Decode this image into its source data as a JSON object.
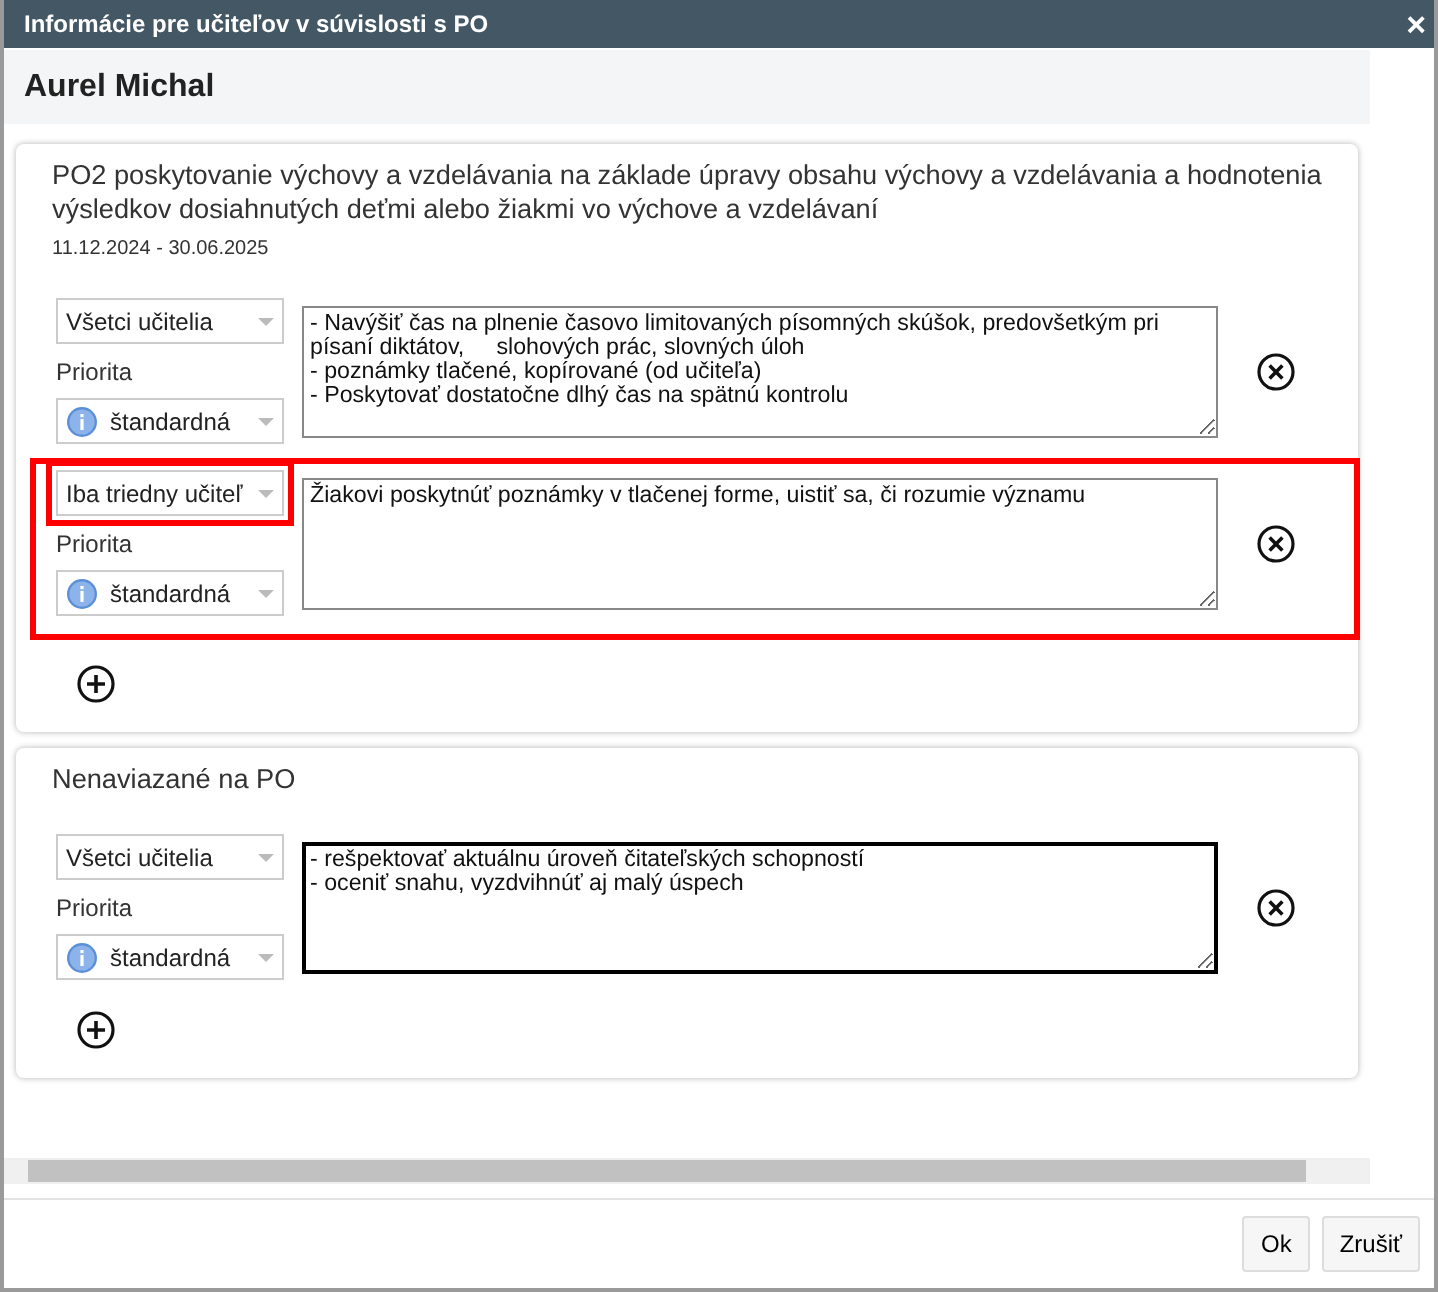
{
  "window": {
    "title": "Informácie pre učiteľov v súvislosti s PO",
    "close": "×"
  },
  "student": "Aurel Michal",
  "sections": [
    {
      "title": "PO2 poskytovanie výchovy a vzdelávania na základe úpravy obsahu výchovy a vzdelávania a hodnotenia výsledkov dosiahnutých deťmi alebo žiakmi vo výchove a vzdelávaní",
      "dates": "11.12.2024 - 30.06.2025",
      "rows": [
        {
          "audience": "Všetci učitelia",
          "priority_label": "Priorita",
          "priority": "štandardná",
          "text": "- Navýšiť čas na plnenie časovo limitovaných písomných skúšok, predovšetkým pri písaní diktátov,     slohových prác, slovných úloh\n- poznámky tlačené, kopírované (od učiteľa)\n- Poskytovať dostatočne dlhý čas na spätnú kontrolu",
          "highlighted": false,
          "focused": false
        },
        {
          "audience": "Iba triedny učiteľ",
          "priority_label": "Priorita",
          "priority": "štandardná",
          "text": "Žiakovi poskytnúť poznámky v tlačenej forme, uistiť sa, či rozumie významu",
          "highlighted": true,
          "focused": false
        }
      ]
    },
    {
      "title": "Nenaviazané na PO",
      "rows": [
        {
          "audience": "Všetci učitelia",
          "priority_label": "Priorita",
          "priority": "štandardná",
          "text": "- rešpektovať aktuálnu úroveň čitateľských schopností\n- oceniť snahu, vyzdvihnúť aj malý úspech\n",
          "highlighted": false,
          "focused": true
        }
      ]
    }
  ],
  "buttons": [
    "Ok",
    "Zrušiť"
  ]
}
